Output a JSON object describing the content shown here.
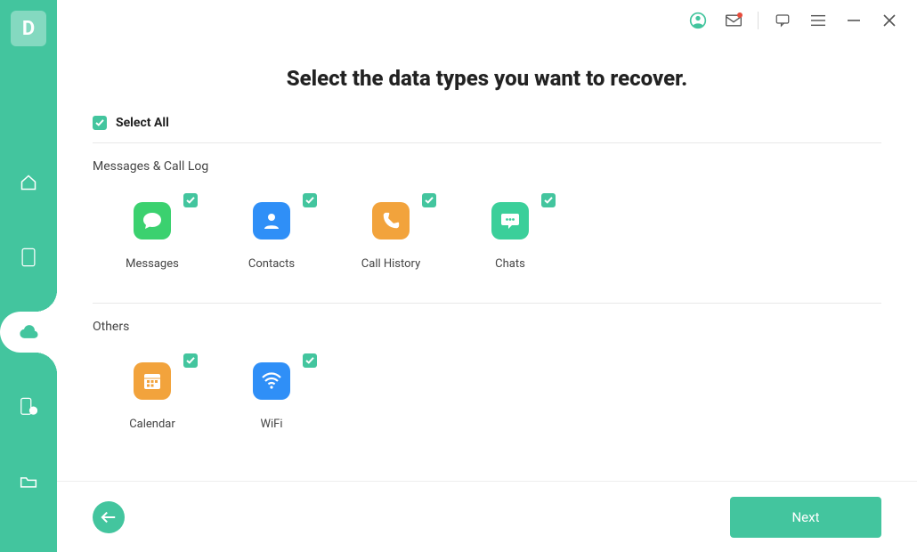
{
  "app": {
    "logo_letter": "D"
  },
  "titlebar": {
    "account_icon": "account-icon",
    "mail_icon": "mail-icon",
    "feedback_icon": "feedback-icon",
    "menu_icon": "menu-icon",
    "minimize_icon": "minimize-icon",
    "close_icon": "close-icon"
  },
  "sidebar": {
    "items": [
      {
        "name": "home-icon"
      },
      {
        "name": "phone-icon"
      },
      {
        "name": "cloud-icon"
      },
      {
        "name": "device-alert-icon"
      },
      {
        "name": "folder-icon"
      }
    ]
  },
  "heading": "Select the data types you want to recover.",
  "select_all_label": "Select All",
  "sections": [
    {
      "title": "Messages & Call Log",
      "items": [
        {
          "label": "Messages",
          "name": "tile-messages",
          "icon_color": "ic-green",
          "icon": "messages-icon"
        },
        {
          "label": "Contacts",
          "name": "tile-contacts",
          "icon_color": "ic-blue",
          "icon": "contacts-icon"
        },
        {
          "label": "Call History",
          "name": "tile-call-history",
          "icon_color": "ic-orange",
          "icon": "phone-solid-icon"
        },
        {
          "label": "Chats",
          "name": "tile-chats",
          "icon_color": "ic-teal",
          "icon": "chats-icon"
        }
      ]
    },
    {
      "title": "Others",
      "items": [
        {
          "label": "Calendar",
          "name": "tile-calendar",
          "icon_color": "ic-orange",
          "icon": "calendar-icon"
        },
        {
          "label": "WiFi",
          "name": "tile-wifi",
          "icon_color": "ic-blue",
          "icon": "wifi-icon"
        }
      ]
    }
  ],
  "buttons": {
    "back_icon": "arrow-left-icon",
    "next_label": "Next"
  }
}
